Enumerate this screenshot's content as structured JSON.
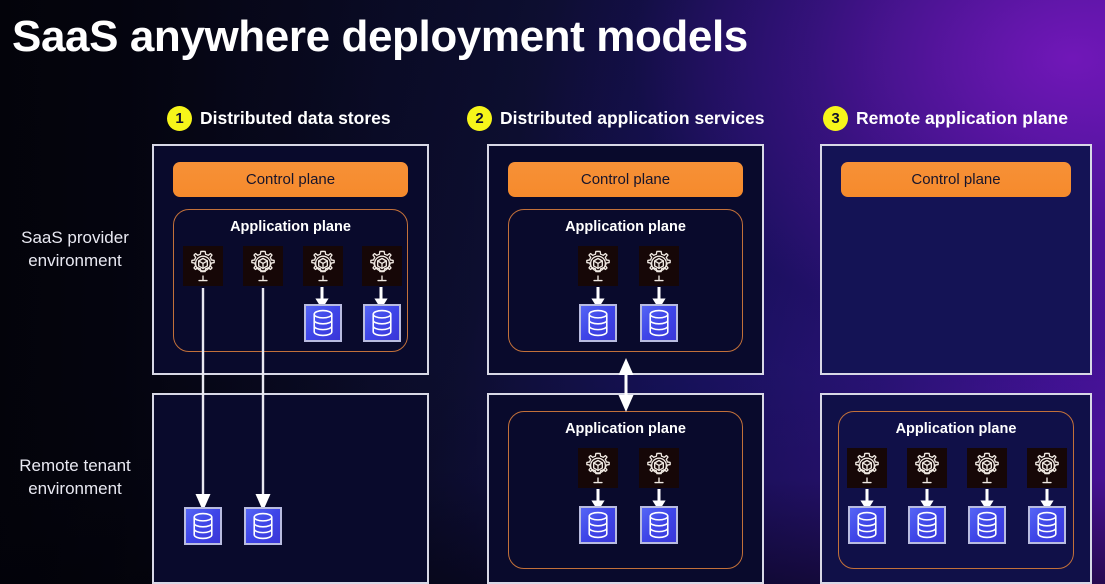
{
  "page": {
    "title": "SaaS anywhere deployment models"
  },
  "colors": {
    "badge_yellow": "#F7F51A",
    "control_plane_orange": "#F79137",
    "app_plane_border": "#C2703A",
    "panel_border": "#D8D8E6",
    "database_blue": "#4A52F0",
    "arrow_white": "#FFFFFF",
    "title_white": "#FFFFFF",
    "background_navy": "#090A2C",
    "background_purple": "#5413A8"
  },
  "row_labels": [
    {
      "id": "provider",
      "line1": "SaaS provider",
      "line2": "environment"
    },
    {
      "id": "tenant",
      "line1": "Remote tenant",
      "line2": "environment"
    }
  ],
  "columns": [
    {
      "number": "1",
      "header": "Distributed data stores",
      "top_panel": {
        "control_plane_label": "Control plane",
        "app_plane_label": "Application plane",
        "gears": 4,
        "databases": 2,
        "short_arrows": 2
      },
      "bottom_panel": {
        "app_plane_label": null,
        "gears": 0,
        "databases": 2,
        "long_arrows": 2
      }
    },
    {
      "number": "2",
      "header": "Distributed application services",
      "top_panel": {
        "control_plane_label": "Control plane",
        "app_plane_label": "Application plane",
        "gears": 2,
        "databases": 2,
        "short_arrows": 2
      },
      "bottom_panel": {
        "app_plane_label": "Application plane",
        "gears": 2,
        "databases": 2,
        "short_arrows": 2
      },
      "connector": "bidirectional-vertical-arrow"
    },
    {
      "number": "3",
      "header": "Remote application plane",
      "top_panel": {
        "control_plane_label": "Control plane",
        "app_plane_label": null,
        "gears": 0,
        "databases": 0
      },
      "bottom_panel": {
        "app_plane_label": "Application plane",
        "gears": 4,
        "databases": 4,
        "short_arrows": 4
      }
    }
  ],
  "icons": {
    "gear": "gear-cube-icon",
    "database": "database-cylinder-icon",
    "arrow_down": "arrow-down-icon",
    "arrow_bidirectional": "arrow-up-down-icon"
  }
}
